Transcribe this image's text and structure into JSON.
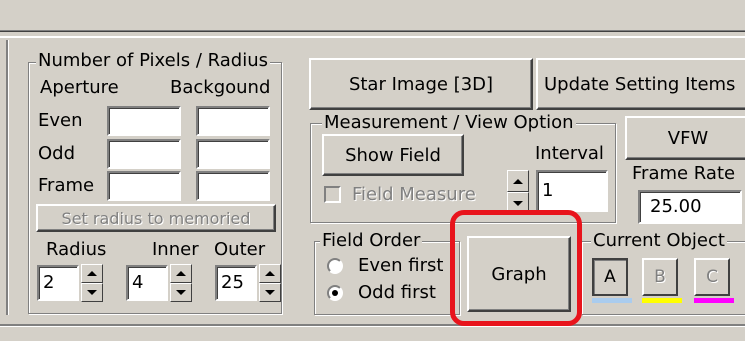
{
  "pixels_group": {
    "title": "Number of Pixels / Radius",
    "col_aperture": "Aperture",
    "col_background": "Backgound",
    "row_even": "Even",
    "row_odd": "Odd",
    "row_frame": "Frame",
    "set_radius_button": "Set  radius to memoried",
    "radius_label": "Radius",
    "inner_label": "Inner",
    "outer_label": "Outer",
    "radius_value": "2",
    "inner_value": "4",
    "outer_value": "25"
  },
  "toolbar": {
    "star_image_button": "Star Image [3D]",
    "update_settings_button": "Update Setting Items",
    "vfw_button": "VFW"
  },
  "measurement_group": {
    "title": "Measurement / View Option",
    "show_field_button": "Show Field",
    "interval_label": "Interval",
    "interval_value": "1",
    "field_measure_label": "Field Measure",
    "field_measure_checked": false
  },
  "frame_rate": {
    "label": "Frame Rate",
    "value": "25.00"
  },
  "field_order_group": {
    "title": "Field Order",
    "even_first": "Even first",
    "odd_first": "Odd first",
    "selected": "Odd first"
  },
  "graph_button": "Graph",
  "current_object_group": {
    "title": "Current Object",
    "objects": [
      {
        "label": "A",
        "color": "#aaccee",
        "enabled": true
      },
      {
        "label": "B",
        "color": "#ffff00",
        "enabled": false
      },
      {
        "label": "C",
        "color": "#ff00ff",
        "enabled": false
      }
    ]
  },
  "highlight_color": "#e8141c"
}
